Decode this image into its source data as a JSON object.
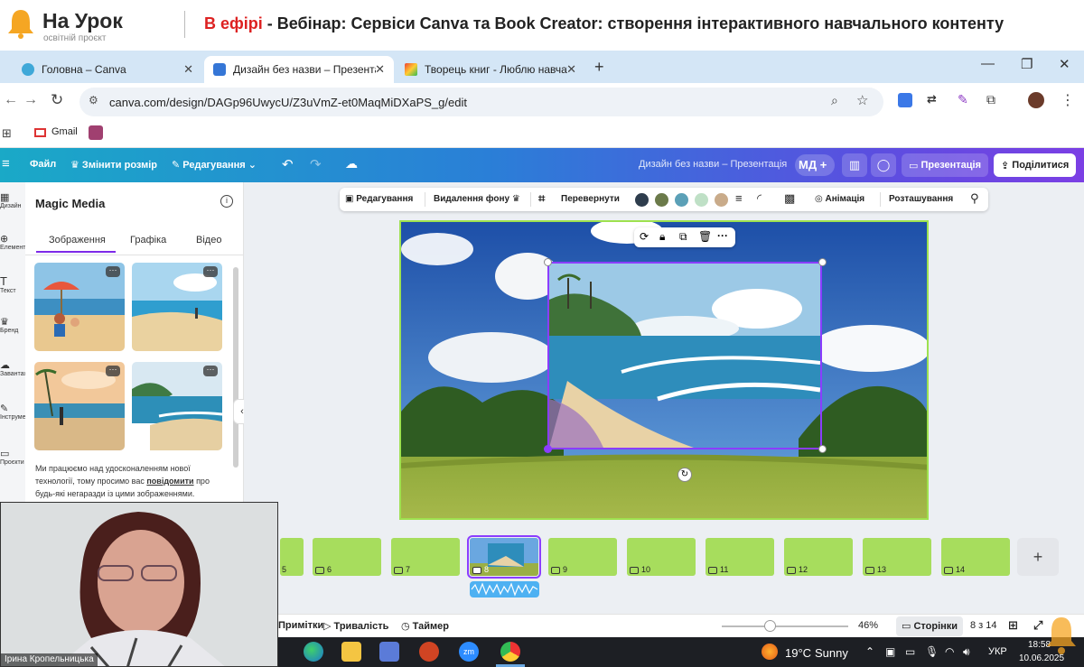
{
  "banner": {
    "logo_name": "На Урок",
    "logo_sub": "освітній проєкт",
    "live_label": "В ефірі",
    "title": " - Вебінар: Сервіси Canva та Book Creator: створення інтерактивного навчального контенту"
  },
  "browser": {
    "tabs": [
      {
        "label": "Головна – Canva",
        "active": false
      },
      {
        "label": "Дизайн без назви – Презентація",
        "active": true
      },
      {
        "label": "Творець книг - Люблю навчатися",
        "active": false
      }
    ],
    "url": "canva.com/design/DAGp96UwycU/Z3uVmZ-et0MaqMiDXaPS_g/edit",
    "bookmarks": [
      {
        "label": "Gmail"
      }
    ]
  },
  "canva": {
    "file_label": "Файл",
    "resize_label": "Змінити розмір",
    "edit_label": "Редагування",
    "design_name": "Дизайн без назви – Презентація",
    "avatar_initials": "МД",
    "present_label": "Презентація",
    "share_label": "Поділитися"
  },
  "rail": {
    "items": [
      "Дизайн",
      "Елементи",
      "Текст",
      "Бренд",
      "Завантажені",
      "Інструменти",
      "Проєкти"
    ]
  },
  "magic_media": {
    "title": "Magic Media",
    "tabs": [
      "Зображення",
      "Графіка",
      "Відео"
    ],
    "note_pre": "Ми працюємо над удосконаленням нової технології, тому просимо вас ",
    "note_link": "повідомити",
    "note_post": " про будь-які негаразди із цими зображеннями."
  },
  "context_toolbar": {
    "edit": "Редагування",
    "remove_bg": "Видалення фону",
    "flip": "Перевернути",
    "animation": "Анімація",
    "position": "Розташування",
    "colors": [
      "#2e3d4d",
      "#6b7a4a",
      "#5ba0b7",
      "#bfe0c6",
      "#c9ab8a"
    ]
  },
  "filmstrip": {
    "pages": [
      "5",
      "6",
      "7",
      "8",
      "9",
      "10",
      "11",
      "12",
      "13",
      "14"
    ],
    "current": "8"
  },
  "bottombar": {
    "notes": "Примітки",
    "duration": "Тривалість",
    "timer": "Таймер",
    "zoom": "46%",
    "pages": "Сторінки",
    "page_count": "8 з 14"
  },
  "webcam": {
    "name": "Ірина Кропельницька"
  },
  "taskbar": {
    "temp": "19°C",
    "weather": "Sunny",
    "lang": "УКР",
    "time": "18:58",
    "date": "10.06.2025"
  }
}
